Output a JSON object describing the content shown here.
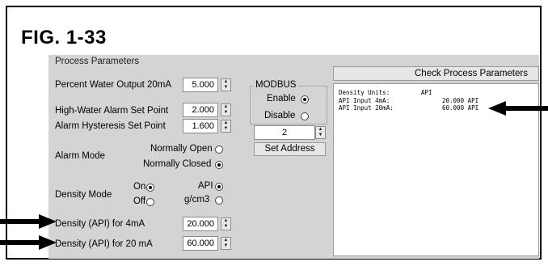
{
  "figure": {
    "title": "FIG. 1-33"
  },
  "panel": {
    "section_title": "Process Parameters",
    "percent_water": {
      "label": "Percent Water Output 20mA",
      "value": "5.000"
    },
    "high_water": {
      "label": "High-Water Alarm Set Point",
      "value": "2.000"
    },
    "hysteresis": {
      "label": "Alarm Hysteresis Set Point",
      "value": "1.600"
    },
    "alarm_mode": {
      "label": "Alarm Mode",
      "options": [
        {
          "label": "Normally Open",
          "selected": false
        },
        {
          "label": "Normally Closed",
          "selected": true
        }
      ]
    },
    "density_mode": {
      "label": "Density Mode",
      "on_off": [
        {
          "label": "On",
          "selected": true
        },
        {
          "label": "Off",
          "selected": false
        }
      ],
      "units": [
        {
          "label": "API",
          "selected": true
        },
        {
          "label": "g/cm3",
          "selected": false
        }
      ]
    },
    "density_4ma": {
      "label": "Density (API) for 4mA",
      "value": "20.000"
    },
    "density_20ma": {
      "label": "Density (API) for 20 mA",
      "value": "60.000"
    },
    "modbus": {
      "title": "MODBUS",
      "enable_label": "Enable",
      "enable_selected": true,
      "disable_label": "Disable",
      "disable_selected": false,
      "address": "2",
      "set_address_label": "Set Address"
    },
    "check_button_label": "Check Process Parameters",
    "readout": {
      "line1_key": "Density Units:",
      "line1_value": "API",
      "line2_key": "API Input 4mA:",
      "line2_value": "20.000 API",
      "line3_key": "API Input 20mA:",
      "line3_value": "60.000 API"
    }
  }
}
